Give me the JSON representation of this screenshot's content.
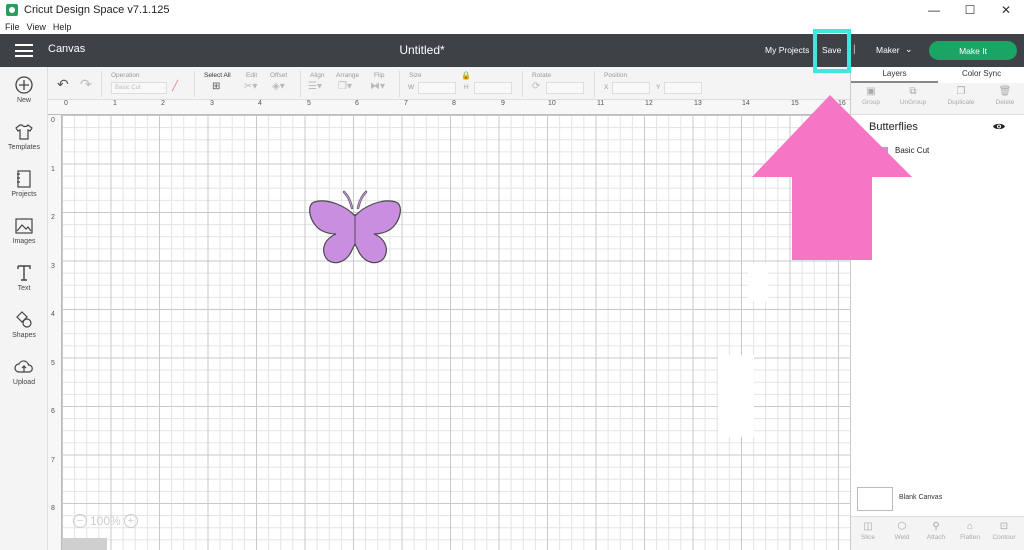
{
  "window": {
    "title": "Cricut Design Space  v7.1.125",
    "controls": [
      "—",
      "☐",
      "✕"
    ]
  },
  "menu": [
    "File",
    "View",
    "Help"
  ],
  "header": {
    "section": "Canvas",
    "doc_title": "Untitled*",
    "my_projects": "My Projects",
    "save": "Save",
    "separator": "|",
    "machine": "Maker",
    "make_it": "Make It",
    "accent_color": "#1aa564"
  },
  "leftbar": [
    {
      "label": "New",
      "icon": "plus-circle-icon"
    },
    {
      "label": "Templates",
      "icon": "shirt-icon"
    },
    {
      "label": "Projects",
      "icon": "notebook-icon"
    },
    {
      "label": "Images",
      "icon": "image-icon"
    },
    {
      "label": "Text",
      "icon": "text-t-icon"
    },
    {
      "label": "Shapes",
      "icon": "shapes-icon"
    },
    {
      "label": "Upload",
      "icon": "cloud-upload-icon"
    }
  ],
  "edit_toolbar": {
    "operation_label": "Operation",
    "operation_value": "Basic Cut",
    "select_all": "Select All",
    "edit": "Edit",
    "offset": "Offset",
    "align": "Align",
    "arrange": "Arrange",
    "flip": "Flip",
    "size": "Size",
    "w": "W",
    "h": "H",
    "rotate": "Rotate",
    "position": "Position",
    "x": "X",
    "y": "Y"
  },
  "ruler": {
    "h": [
      "0",
      "1",
      "2",
      "3",
      "4",
      "5",
      "6",
      "7",
      "8",
      "9",
      "10",
      "11",
      "12",
      "13",
      "14",
      "15",
      "16"
    ],
    "v": [
      "0",
      "1",
      "2",
      "3",
      "4",
      "5",
      "6",
      "7",
      "8"
    ]
  },
  "zoom": {
    "minus": "−",
    "value": "100%",
    "plus": "+"
  },
  "right_panel": {
    "tabs": [
      "Layers",
      "Color Sync"
    ],
    "tools": [
      "Group",
      "UnGroup",
      "Duplicate",
      "Delete"
    ],
    "group_name": "Butterflies",
    "layer_name": "Basic Cut",
    "layer_color": "#c98ee0",
    "blank_canvas": "Blank Canvas",
    "bottom_tools": [
      "Slice",
      "Weld",
      "Attach",
      "Flatten",
      "Contour"
    ]
  },
  "annotation": {
    "highlight_color": "#3ee6e0",
    "arrow_color": "#f577c4"
  }
}
